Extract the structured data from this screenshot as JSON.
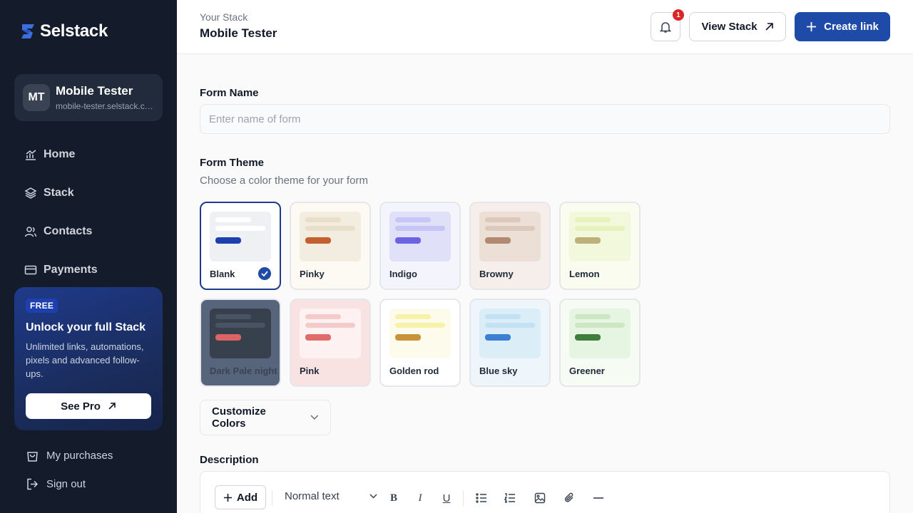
{
  "brand": {
    "name": "Selstack",
    "accent": "#1e4aa8",
    "sidebar_bg": "#141b2b"
  },
  "profile": {
    "initials": "MT",
    "name": "Mobile Tester",
    "url": "mobile-tester.selstack.com"
  },
  "nav": [
    {
      "label": "Home",
      "icon": "chart-icon"
    },
    {
      "label": "Stack",
      "icon": "layers-icon"
    },
    {
      "label": "Contacts",
      "icon": "users-icon"
    },
    {
      "label": "Payments",
      "icon": "card-icon"
    }
  ],
  "promo": {
    "badge": "FREE",
    "title": "Unlock your full Stack",
    "desc": "Unlimited links, automations, pixels and advanced follow-ups.",
    "button": "See Pro"
  },
  "footer": [
    {
      "label": "My purchases",
      "icon": "bag-icon"
    },
    {
      "label": "Sign out",
      "icon": "logout-icon"
    }
  ],
  "header": {
    "breadcrumb": "Your Stack",
    "title": "Mobile Tester",
    "notification_count": "1",
    "view_stack": "View Stack",
    "create_link": "Create link"
  },
  "form": {
    "name_label": "Form Name",
    "name_placeholder": "Enter name of form",
    "theme_label": "Form Theme",
    "theme_sub": "Choose a color theme for your form",
    "selected_theme": "Blank",
    "themes": [
      {
        "name": "Blank",
        "bg": "#ffffff",
        "swatch": "#eef0f3",
        "line": "#ffffff",
        "accent": "#1e40af",
        "text": "#1f2937"
      },
      {
        "name": "Pinky",
        "bg": "#fdfaf3",
        "swatch": "#f3ece0",
        "line": "#e9dfc9",
        "accent": "#c2612f",
        "text": "#1f2937"
      },
      {
        "name": "Indigo",
        "bg": "#f4f4fd",
        "swatch": "#e0e0f8",
        "line": "#c7c5f5",
        "accent": "#6b63e0",
        "text": "#1f2937"
      },
      {
        "name": "Browny",
        "bg": "#f6eeea",
        "swatch": "#ecdfd6",
        "line": "#dcc9bc",
        "accent": "#b08970",
        "text": "#1f2937"
      },
      {
        "name": "Lemon",
        "bg": "#f9fcef",
        "swatch": "#f1f8dc",
        "line": "#e7f1be",
        "accent": "#bdb07a",
        "text": "#1f2937"
      },
      {
        "name": "Dark Pale night",
        "bg": "#57657c",
        "swatch": "#37404d",
        "line": "#4a5363",
        "accent": "#dc6464",
        "text": "#3a4353"
      },
      {
        "name": "Pink",
        "bg": "#f8e2e2",
        "swatch": "#fdf1f1",
        "line": "#f4caca",
        "accent": "#e06b6b",
        "text": "#1f2937"
      },
      {
        "name": "Golden rod",
        "bg": "#ffffff",
        "swatch": "#fdfcec",
        "line": "#f7f2a8",
        "accent": "#c8913a",
        "text": "#1f2937"
      },
      {
        "name": "Blue sky",
        "bg": "#eff6fb",
        "swatch": "#dbeef8",
        "line": "#c2e1f4",
        "accent": "#3b7fd4",
        "text": "#1f2937"
      },
      {
        "name": "Greener",
        "bg": "#f6fbf4",
        "swatch": "#e6f4e2",
        "line": "#cde7c5",
        "accent": "#3e7d3b",
        "text": "#1f2937"
      }
    ],
    "customize": "Customize Colors",
    "description_label": "Description"
  },
  "editor": {
    "add": "Add",
    "style": "Normal text",
    "tools": [
      "bold-icon",
      "italic-icon",
      "underline-icon",
      "bullet-list-icon",
      "numbered-list-icon",
      "image-icon",
      "attachment-icon",
      "divider-icon"
    ]
  }
}
